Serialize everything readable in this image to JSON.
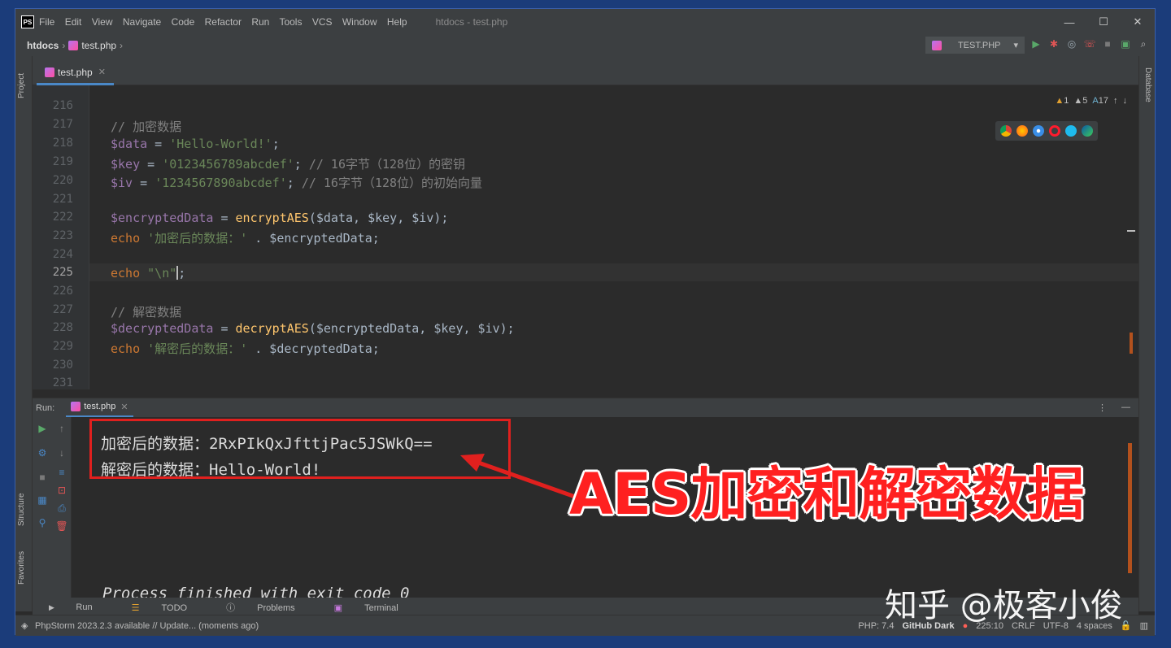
{
  "titlebar": {
    "logo": "PS",
    "menu": [
      "File",
      "Edit",
      "View",
      "Navigate",
      "Code",
      "Refactor",
      "Run",
      "Tools",
      "VCS",
      "Window",
      "Help"
    ],
    "title": "htdocs - test.php",
    "minimize": "—",
    "maximize": "☐",
    "close": "✕"
  },
  "navbar": {
    "project": "htdocs",
    "file": "test.php",
    "run_config": "TEST.PHP"
  },
  "sidebar": {
    "project": "Project",
    "structure": "Structure",
    "favorites": "Favorites",
    "database": "Database"
  },
  "editor": {
    "tab": "test.php",
    "inspections": {
      "warnings": "1",
      "weak": "5",
      "typos": "17"
    },
    "line_numbers": [
      "216",
      "217",
      "218",
      "219",
      "220",
      "221",
      "222",
      "223",
      "224",
      "225",
      "226",
      "227",
      "228",
      "229",
      "230",
      "231"
    ],
    "current_line": "225",
    "lines": {
      "l217": "// 加密数据",
      "l218_var": "$data",
      "l218_str": "'Hello-World!'",
      "l219_var": "$key",
      "l219_str": "'0123456789abcdef'",
      "l219_cm": "// 16字节（128位）的密钥",
      "l220_var": "$iv",
      "l220_str": "'1234567890abcdef'",
      "l220_cm": "// 16字节（128位）的初始向量",
      "l222_var": "$encryptedData",
      "l222_fn": "encryptAES",
      "l222_args": "($data, $key, $iv);",
      "l223_kw": "echo",
      "l223_str": "'加密后的数据：'",
      "l223_rest": " . $encryptedData;",
      "l225_kw": "echo",
      "l225_str": "\"\\n\"",
      "l227": "// 解密数据",
      "l228_var": "$decryptedData",
      "l228_fn": "decryptAES",
      "l228_args": "($encryptedData, $key, $iv);",
      "l229_kw": "echo",
      "l229_str": "'解密后的数据：'",
      "l229_rest": " . $decryptedData;"
    }
  },
  "run": {
    "label": "Run:",
    "tab": "test.php",
    "output": [
      "加密后的数据：2RxPIkQxJfttjPac5JSWkQ==",
      "解密后的数据：Hello-World!"
    ],
    "process": "Process finished with exit code 0"
  },
  "overlay": {
    "caption": "AES加密和解密数据",
    "watermark": "知乎 @极客小俊"
  },
  "tooltabs": [
    "Run",
    "TODO",
    "Problems",
    "Terminal"
  ],
  "status": {
    "message": "PhpStorm 2023.2.3 available // Update... (moments ago)",
    "php": "PHP: 7.4",
    "theme": "GitHub Dark",
    "position": "225:10",
    "line_sep": "CRLF",
    "encoding": "UTF-8",
    "indent": "4 spaces"
  },
  "colors": {
    "background": "#2b2b2b",
    "accent_red": "#e0201e",
    "keyword": "#cc7832",
    "string": "#6a8759"
  }
}
